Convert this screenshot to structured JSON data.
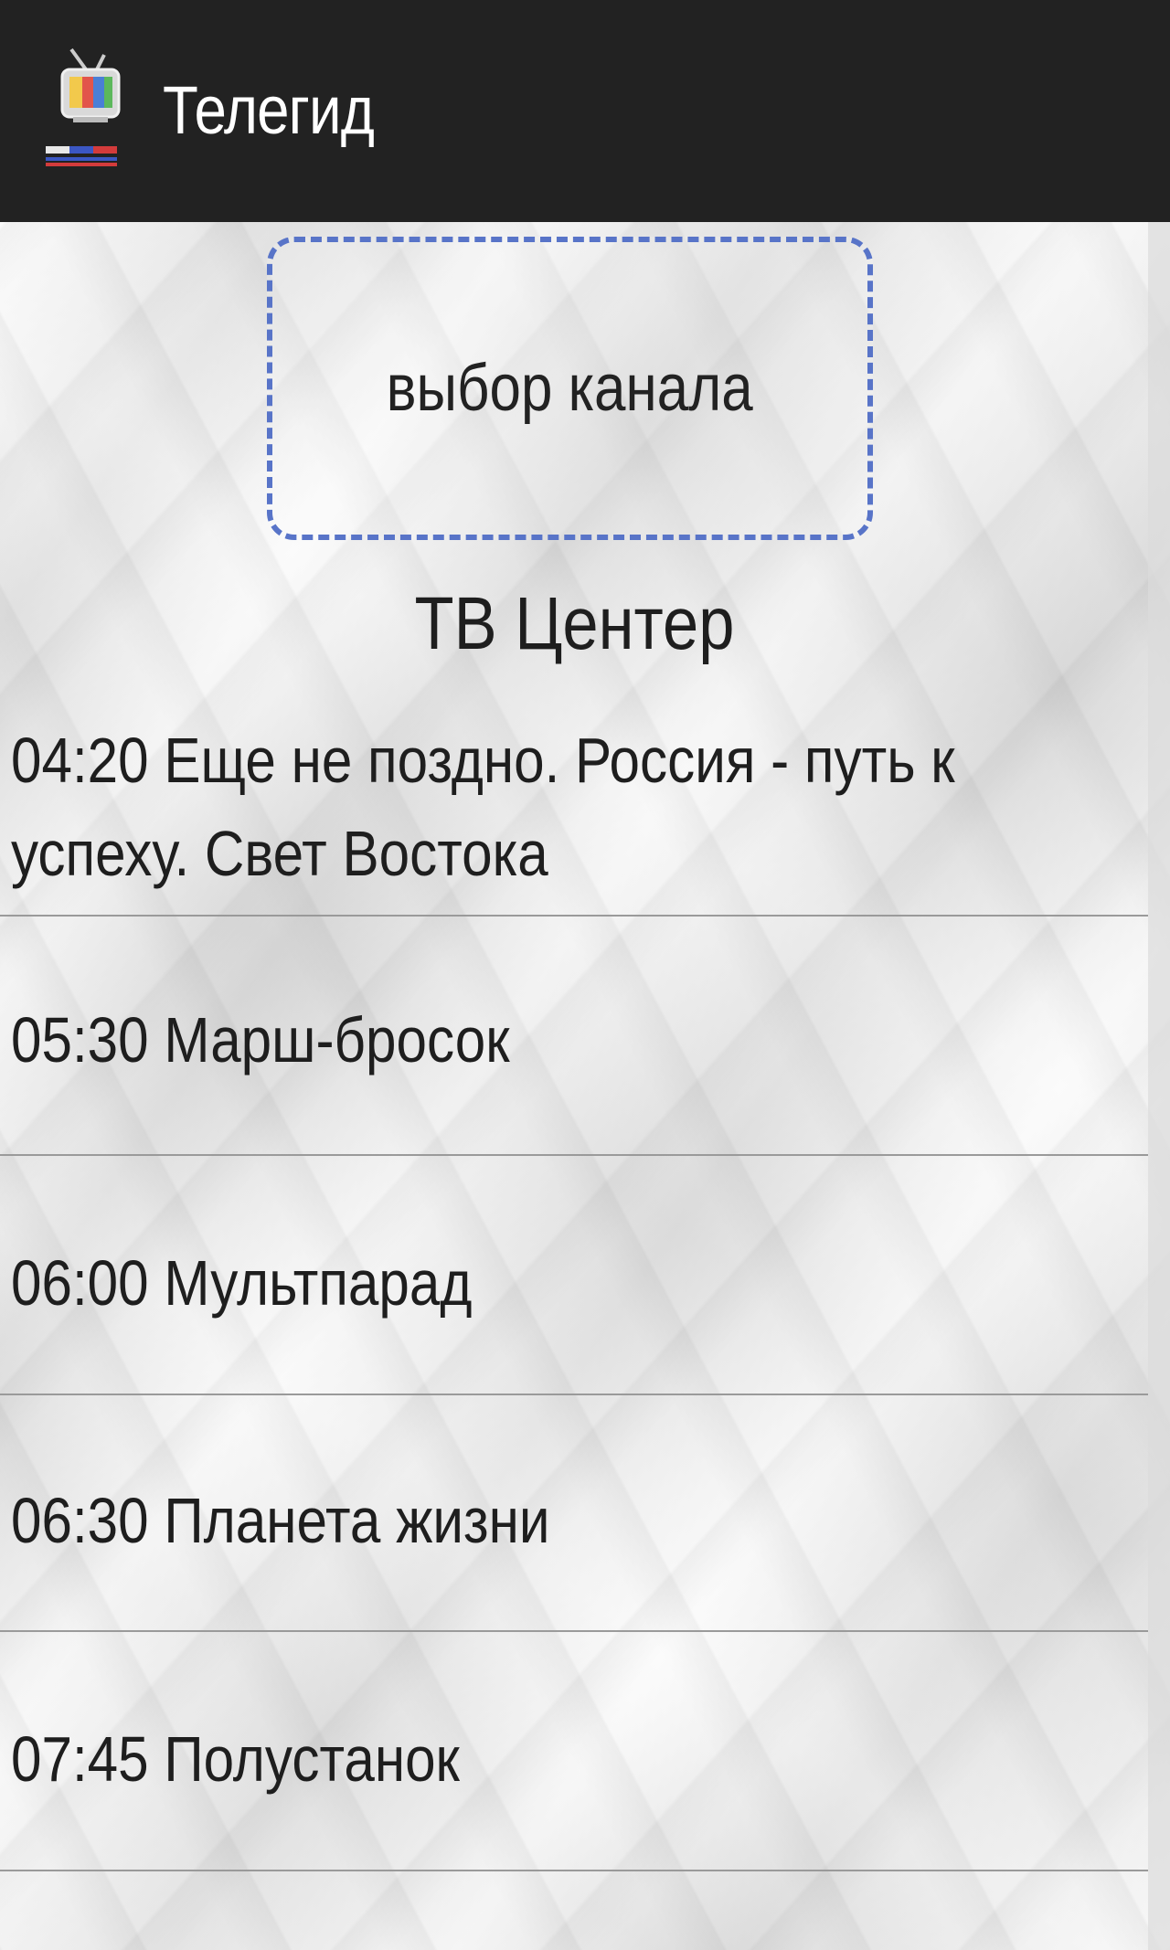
{
  "app": {
    "title": "Телегид",
    "icon": "tv-icon"
  },
  "channel_select": {
    "label": "выбор канала",
    "border_color": "#5874c8"
  },
  "channel": {
    "name": "ТВ Центер"
  },
  "programs": [
    {
      "text": "04:20 Еще не поздно. Россия - путь к успеху. Свет Востока"
    },
    {
      "text": "05:30 Марш-бросок"
    },
    {
      "text": "06:00 Мультпарад"
    },
    {
      "text": "06:30 Планета жизни"
    },
    {
      "text": "07:45 Полустанок"
    },
    {
      "text": ""
    }
  ],
  "colors": {
    "action_bar": "#222222",
    "text": "#1e1e1e",
    "divider": "#9a9a9a"
  }
}
